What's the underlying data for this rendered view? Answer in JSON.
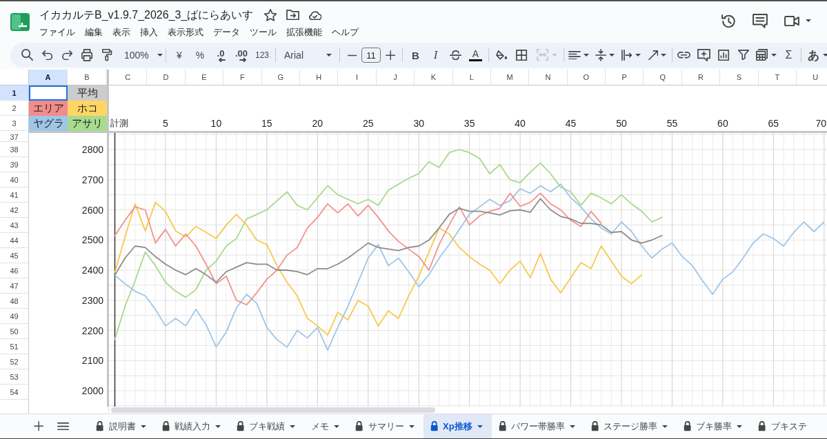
{
  "app": {
    "title": "イカカルテB_v1.9.7_2026_3_ばにらあいす",
    "menu": [
      "ファイル",
      "編集",
      "表示",
      "挿入",
      "表示形式",
      "データ",
      "ツール",
      "拡張機能",
      "ヘルプ"
    ]
  },
  "toolbar": {
    "zoom": "100%",
    "currency": "¥",
    "percent": "%",
    "decimal_decrease": ".0",
    "decimal_increase": ".00",
    "number_format": "123",
    "font": "Arial",
    "font_size": "11",
    "bold": "B",
    "italic": "I",
    "text_color": "A",
    "merge_disabled": true,
    "function": "Σ",
    "input_tool": "あ"
  },
  "sheet": {
    "columns": [
      {
        "label": "A",
        "selected": true
      },
      {
        "label": "B",
        "selected": false
      },
      {
        "label": "C",
        "selected": false
      },
      {
        "label": "D",
        "selected": false
      },
      {
        "label": "E",
        "selected": false
      },
      {
        "label": "F",
        "selected": false
      },
      {
        "label": "G",
        "selected": false
      },
      {
        "label": "H",
        "selected": false
      },
      {
        "label": "I",
        "selected": false
      },
      {
        "label": "J",
        "selected": false
      },
      {
        "label": "K",
        "selected": false
      },
      {
        "label": "L",
        "selected": false
      },
      {
        "label": "M",
        "selected": false
      },
      {
        "label": "N",
        "selected": false
      },
      {
        "label": "O",
        "selected": false
      },
      {
        "label": "P",
        "selected": false
      },
      {
        "label": "Q",
        "selected": false
      },
      {
        "label": "R",
        "selected": false
      },
      {
        "label": "S",
        "selected": false
      },
      {
        "label": "T",
        "selected": false
      },
      {
        "label": "U",
        "selected": false
      }
    ],
    "frozen_rows": [
      {
        "number": "1",
        "selected": true,
        "cells": [
          {
            "selected": true
          },
          {
            "text": "平均",
            "color": "#cccccc",
            "selected": false
          }
        ]
      },
      {
        "number": "2",
        "selected": false,
        "cells": [
          {
            "text": "エリア",
            "color": "#f28b8b",
            "selected": false
          },
          {
            "text": "ホコ",
            "color": "#ffd666",
            "selected": false
          }
        ]
      },
      {
        "number": "3",
        "selected": false,
        "cells": [
          {
            "text": "ヤグラ",
            "color": "#9fc5e8",
            "selected": false
          },
          {
            "text": "アサリ",
            "color": "#a9db8e",
            "selected": false
          },
          {
            "text": "計測",
            "selected": false
          }
        ]
      }
    ],
    "rows": [
      "37",
      "38",
      "39",
      "40",
      "41",
      "42",
      "43",
      "44",
      "45",
      "46",
      "47",
      "48",
      "49",
      "50",
      "51",
      "52",
      "53",
      "54"
    ],
    "chart_data": {
      "type": "line",
      "grid": true,
      "x": [
        0,
        1,
        2,
        3,
        4,
        5,
        6,
        7,
        8,
        9,
        10,
        11,
        12,
        13,
        14,
        15,
        16,
        17,
        18,
        19,
        20,
        21,
        22,
        23,
        24,
        25,
        26,
        27,
        28,
        29,
        30,
        31,
        32,
        33,
        34,
        35,
        36,
        37,
        38,
        39,
        40,
        41,
        42,
        43,
        44,
        45,
        46,
        47,
        48,
        49,
        50,
        51,
        52,
        53,
        54,
        55,
        56,
        57,
        58,
        59,
        60,
        61,
        62,
        63,
        64,
        65,
        66,
        67,
        68,
        69,
        70
      ],
      "xlim": [
        0,
        70
      ],
      "ylim": [
        2000,
        2800
      ],
      "xticks": [
        5,
        10,
        15,
        20,
        25,
        30,
        35,
        40,
        45,
        50,
        55,
        60,
        65,
        70
      ],
      "yticks": [
        2000,
        2100,
        2200,
        2300,
        2400,
        2500,
        2600,
        2700,
        2800
      ],
      "series": [
        {
          "color": "#8c8c8c",
          "values": [
            2383,
            2440,
            2480,
            2475,
            2445,
            2420,
            2400,
            2385,
            2405,
            2385,
            2360,
            2395,
            2410,
            2425,
            2420,
            2420,
            2400,
            2400,
            2395,
            2385,
            2405,
            2405,
            2420,
            2440,
            2465,
            2490,
            2475,
            2470,
            2465,
            2475,
            2480,
            2500,
            2540,
            2585,
            2605,
            2595,
            2595,
            2590,
            2583,
            2597,
            2600,
            2592,
            2637,
            2600,
            2578,
            2570,
            2555,
            2555,
            2550,
            2525,
            2528,
            2500,
            2490,
            2500,
            2515,
            null,
            null,
            null,
            null,
            null,
            null,
            null,
            null,
            null,
            null,
            null,
            null,
            null,
            null,
            null,
            null
          ]
        },
        {
          "color": "#f4918b",
          "values": [
            2514,
            2565,
            2610,
            2600,
            2490,
            2535,
            2480,
            2520,
            2480,
            2420,
            2355,
            2380,
            2300,
            2285,
            2325,
            2370,
            2400,
            2450,
            2475,
            2540,
            2575,
            2620,
            2590,
            2620,
            2580,
            2615,
            2575,
            2530,
            2495,
            2470,
            2445,
            2400,
            2485,
            2550,
            2610,
            2550,
            2580,
            2595,
            2605,
            2655,
            2612,
            2625,
            2655,
            2620,
            2600,
            2565,
            2545,
            2595,
            2555,
            null,
            null,
            null,
            null,
            null,
            null,
            null,
            null,
            null,
            null,
            null,
            null,
            null,
            null,
            null,
            null,
            null,
            null,
            null,
            null,
            null,
            null
          ]
        },
        {
          "color": "#f8c84a",
          "values": [
            2393,
            2510,
            2620,
            2530,
            2625,
            2595,
            2530,
            2510,
            2545,
            2525,
            2505,
            2550,
            2585,
            2550,
            2500,
            2485,
            2415,
            2360,
            2315,
            2240,
            2215,
            2185,
            2260,
            2235,
            2300,
            2280,
            2215,
            2265,
            2240,
            2315,
            2380,
            2460,
            2540,
            2520,
            2475,
            2445,
            2420,
            2400,
            2355,
            2400,
            2430,
            2375,
            2455,
            2370,
            2325,
            2375,
            2425,
            2405,
            2480,
            2430,
            2380,
            2355,
            2385,
            null,
            null,
            null,
            null,
            null,
            null,
            null,
            null,
            null,
            null,
            null,
            null,
            null,
            null,
            null,
            null,
            null,
            null
          ]
        },
        {
          "color": "#9fc5e8",
          "values": [
            2383,
            2355,
            2330,
            2315,
            2270,
            2215,
            2240,
            2215,
            2270,
            2220,
            2145,
            2195,
            2275,
            2320,
            2290,
            2210,
            2170,
            2145,
            2200,
            2175,
            2210,
            2135,
            2210,
            2280,
            2360,
            2440,
            2485,
            2415,
            2440,
            2395,
            2345,
            2385,
            2440,
            2485,
            2535,
            2585,
            2610,
            2635,
            2615,
            2630,
            2670,
            2655,
            2680,
            2660,
            2685,
            2640,
            2610,
            2570,
            2540,
            2520,
            2560,
            2528,
            2480,
            2440,
            2470,
            2490,
            2445,
            2415,
            2365,
            2320,
            2370,
            2395,
            2440,
            2490,
            2520,
            2505,
            2480,
            2525,
            2560,
            2528,
            2560
          ]
        },
        {
          "color": "#a6d98c",
          "values": [
            2170,
            2280,
            2365,
            2460,
            2415,
            2360,
            2330,
            2310,
            2335,
            2400,
            2430,
            2480,
            2505,
            2570,
            2585,
            2600,
            2630,
            2660,
            2615,
            2600,
            2640,
            2680,
            2650,
            2635,
            2620,
            2635,
            2615,
            2665,
            2685,
            2705,
            2720,
            2760,
            2740,
            2790,
            2800,
            2790,
            2770,
            2720,
            2750,
            2700,
            2690,
            2725,
            2755,
            2720,
            2675,
            2660,
            2615,
            2655,
            2640,
            2620,
            2650,
            2620,
            2595,
            2560,
            2575,
            null,
            null,
            null,
            null,
            null,
            null,
            null,
            null,
            null,
            null,
            null,
            null,
            null,
            null,
            null,
            null
          ]
        }
      ]
    }
  },
  "sheet_tabs": [
    {
      "label": "説明書",
      "locked": true,
      "selected": false,
      "dropdown": true
    },
    {
      "label": "戦績入力",
      "locked": true,
      "selected": false,
      "dropdown": true
    },
    {
      "label": "ブキ戦績",
      "locked": true,
      "selected": false,
      "dropdown": true
    },
    {
      "label": "メモ",
      "locked": false,
      "selected": false,
      "dropdown": true
    },
    {
      "label": "サマリー",
      "locked": true,
      "selected": false,
      "dropdown": true
    },
    {
      "label": "Xp推移",
      "locked": true,
      "selected": true,
      "dropdown": true
    },
    {
      "label": "パワー帯勝率",
      "locked": true,
      "selected": false,
      "dropdown": true
    },
    {
      "label": "ステージ勝率",
      "locked": true,
      "selected": false,
      "dropdown": true
    },
    {
      "label": "ブキ勝率",
      "locked": true,
      "selected": false,
      "dropdown": true
    },
    {
      "label": "ブキステ",
      "locked": true,
      "selected": false,
      "dropdown": false
    }
  ]
}
